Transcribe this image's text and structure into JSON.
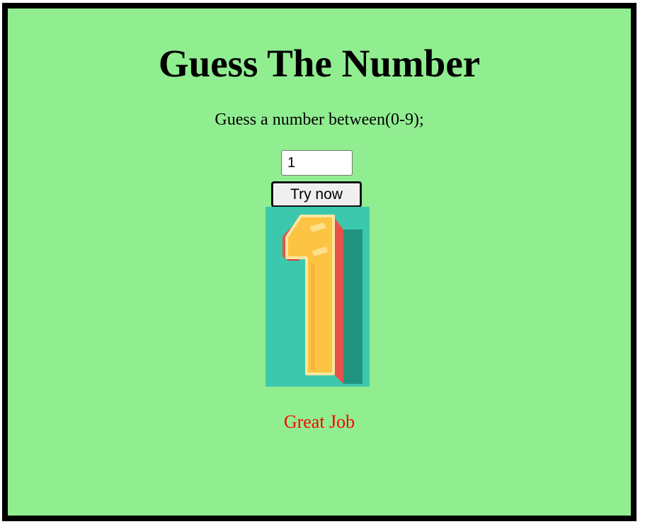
{
  "page": {
    "title": "Guess The Number",
    "instruction": "Guess a number between(0-9);",
    "result_message": "Great Job"
  },
  "form": {
    "guess_value": "1",
    "submit_label": "Try now"
  },
  "image": {
    "icon": "number-one-icon"
  },
  "colors": {
    "background": "#90ee90",
    "border": "#000000",
    "result_text": "#ff0000",
    "image_background": "#3cc8ad"
  }
}
